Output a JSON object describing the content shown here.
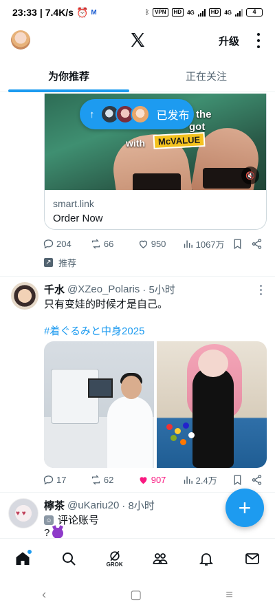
{
  "status_bar": {
    "time": "23:33",
    "speed": "7.4K/s",
    "vpn": "VPN",
    "hd1": "HD",
    "net1": "4G",
    "hd2": "HD",
    "net2": "4G",
    "battery": "4"
  },
  "header": {
    "upgrade_label": "升级"
  },
  "tabs": [
    {
      "label": "为你推荐",
      "active": true
    },
    {
      "label": "正在关注",
      "active": false
    }
  ],
  "ad": {
    "image_text": {
      "line1": "the",
      "line2": "got",
      "line3": "with",
      "badge": "McVALUE"
    },
    "domain": "smart.link",
    "cta": "Order Now",
    "stats": {
      "replies": "204",
      "reposts": "66",
      "likes": "950",
      "views": "1067万"
    },
    "promoted_label": "推荐"
  },
  "posted_pill": {
    "label": "已发布"
  },
  "tweet1": {
    "name": "千水",
    "handle": "@XZeo_Polaris",
    "time": "· 5小时",
    "text": "只有变娃的时候才是自己。",
    "hashtag": "#着ぐるみと中身2025",
    "stats": {
      "replies": "17",
      "reposts": "62",
      "likes": "907",
      "views": "2.4万"
    }
  },
  "tweet2": {
    "name": "檸茶",
    "handle": "@uKariu20",
    "time": "· 8小时",
    "badge_label": "评论账号",
    "text": "?"
  },
  "bottom_nav": {
    "grok_label": "GROK"
  },
  "colors": {
    "accent": "#1d9bf0",
    "like": "#f91880",
    "muted": "#536471"
  }
}
